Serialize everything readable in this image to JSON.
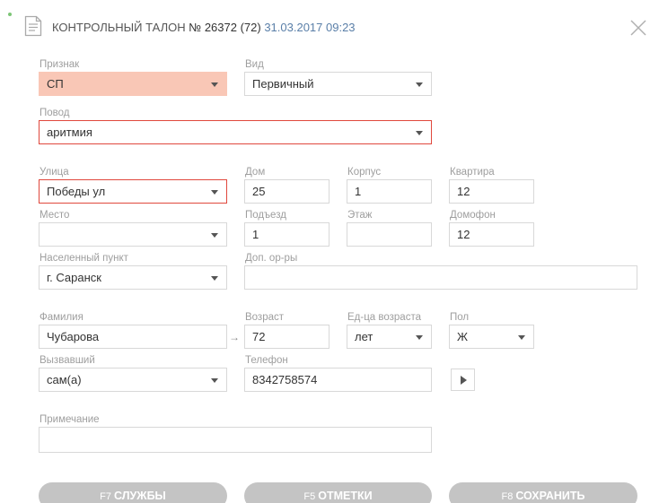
{
  "header": {
    "title": "КОНТРОЛЬНЫЙ ТАЛОН",
    "number": "№ 26372 (72)",
    "datetime": "31.03.2017 09:23",
    "close_icon": "close-icon",
    "doc_icon": "document-icon"
  },
  "form": {
    "priznak": {
      "label": "Признак",
      "value": "СП"
    },
    "vid": {
      "label": "Вид",
      "value": "Первичный"
    },
    "povod": {
      "label": "Повод",
      "value": "аритмия"
    },
    "ulica": {
      "label": "Улица",
      "value": "Победы ул"
    },
    "dom": {
      "label": "Дом",
      "value": "25"
    },
    "korpus": {
      "label": "Корпус",
      "value": "1"
    },
    "kvartira": {
      "label": "Квартира",
      "value": "12"
    },
    "mesto": {
      "label": "Место",
      "value": ""
    },
    "podezd": {
      "label": "Подъезд",
      "value": "1"
    },
    "etazh": {
      "label": "Этаж",
      "value": ""
    },
    "domofon": {
      "label": "Домофон",
      "value": "12"
    },
    "nas_punkt": {
      "label": "Населенный пункт",
      "value": "г. Саранск"
    },
    "dop_ory": {
      "label": "Доп. ор-ры",
      "value": ""
    },
    "familiya": {
      "label": "Фамилия",
      "value": "Чубарова"
    },
    "vozrast": {
      "label": "Возраст",
      "value": "72"
    },
    "ed_vozrasta": {
      "label": "Ед-ца возраста",
      "value": "лет"
    },
    "pol": {
      "label": "Пол",
      "value": "Ж"
    },
    "vyzvavshiy": {
      "label": "Вызвавший",
      "value": "сам(а)"
    },
    "telefon": {
      "label": "Телефон",
      "value": "8342758574"
    },
    "primechanie": {
      "label": "Примечание",
      "value": ""
    },
    "arrow": "→"
  },
  "buttons": {
    "sluzhby": {
      "key": "F7",
      "label": "СЛУЖБЫ"
    },
    "otmetki": {
      "key": "F5",
      "label": "ОТМЕТКИ"
    },
    "sohranit": {
      "key": "F8",
      "label": "СОХРАНИТЬ"
    }
  },
  "colors": {
    "required_pink": "#f9c7b6",
    "error_red": "#e0483d",
    "datetime_blue": "#5a7fa8",
    "button_gray": "#c4c4c4",
    "status_dot": "#7cc576"
  }
}
